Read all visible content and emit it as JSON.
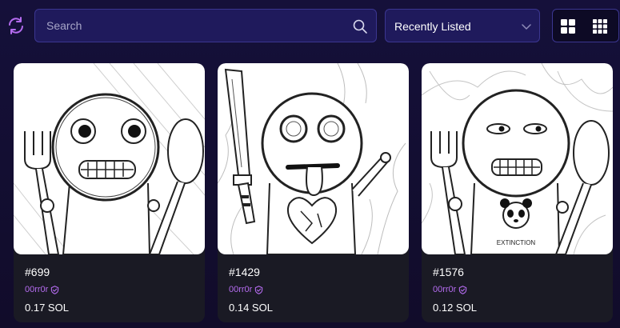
{
  "toolbar": {
    "search_placeholder": "Search",
    "sort_label": "Recently Listed"
  },
  "colors": {
    "background": "#120d2e",
    "input_bg": "#1f1a5c",
    "accent": "#b56cf0",
    "card_bg": "#1a1a24"
  },
  "icons": {
    "refresh": "refresh-icon",
    "search": "search-icon",
    "sort": "chevron-down-icon",
    "view_large": "grid-large-icon",
    "view_small": "grid-small-icon",
    "verified": "verified-badge-icon"
  },
  "cards": [
    {
      "title": "#699",
      "creator": "00rr0r",
      "price": "0.17 SOL"
    },
    {
      "title": "#1429",
      "creator": "00rr0r",
      "price": "0.14 SOL"
    },
    {
      "title": "#1576",
      "creator": "00rr0r",
      "price": "0.12 SOL",
      "shirt_text": "EXTINCTION"
    }
  ]
}
